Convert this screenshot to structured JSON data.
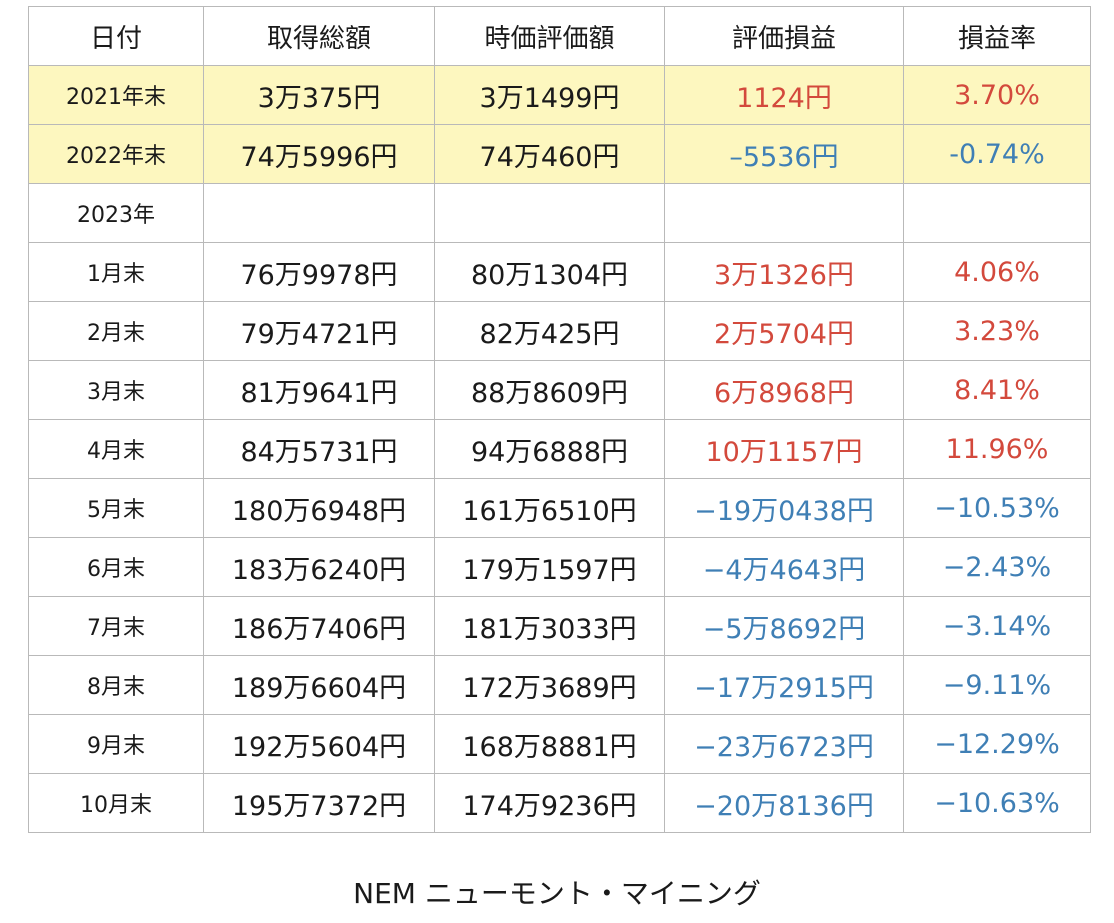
{
  "headers": {
    "date": "日付",
    "cost": "取得総額",
    "market": "時価評価額",
    "pl": "評価損益",
    "rate": "損益率"
  },
  "rows": [
    {
      "date": "2021年末",
      "cost": "3万375円",
      "market": "3万1499円",
      "pl": "1124円",
      "rate": "3.70%",
      "sign": "pos",
      "highlight": true
    },
    {
      "date": "2022年末",
      "cost": "74万5996円",
      "market": "74万460円",
      "pl": "–5536円",
      "rate": "-0.74%",
      "sign": "neg",
      "highlight": true
    },
    {
      "date": "2023年",
      "cost": "",
      "market": "",
      "pl": "",
      "rate": "",
      "sign": "",
      "highlight": false
    },
    {
      "date": "1月末",
      "cost": "76万9978円",
      "market": "80万1304円",
      "pl": "3万1326円",
      "rate": "4.06%",
      "sign": "pos",
      "highlight": false
    },
    {
      "date": "2月末",
      "cost": "79万4721円",
      "market": "82万425円",
      "pl": "2万5704円",
      "rate": "3.23%",
      "sign": "pos",
      "highlight": false
    },
    {
      "date": "3月末",
      "cost": "81万9641円",
      "market": "88万8609円",
      "pl": "6万8968円",
      "rate": "8.41%",
      "sign": "pos",
      "highlight": false
    },
    {
      "date": "4月末",
      "cost": "84万5731円",
      "market": "94万6888円",
      "pl": "10万1157円",
      "rate": "11.96%",
      "sign": "pos",
      "highlight": false
    },
    {
      "date": "5月末",
      "cost": "180万6948円",
      "market": "161万6510円",
      "pl": "−19万0438円",
      "rate": "−10.53%",
      "sign": "neg",
      "highlight": false
    },
    {
      "date": "6月末",
      "cost": "183万6240円",
      "market": "179万1597円",
      "pl": "−4万4643円",
      "rate": "−2.43%",
      "sign": "neg",
      "highlight": false
    },
    {
      "date": "7月末",
      "cost": "186万7406円",
      "market": "181万3033円",
      "pl": "−5万8692円",
      "rate": "−3.14%",
      "sign": "neg",
      "highlight": false
    },
    {
      "date": "8月末",
      "cost": "189万6604円",
      "market": "172万3689円",
      "pl": "−17万2915円",
      "rate": "−9.11%",
      "sign": "neg",
      "highlight": false
    },
    {
      "date": "9月末",
      "cost": "192万5604円",
      "market": "168万8881円",
      "pl": "−23万6723円",
      "rate": "−12.29%",
      "sign": "neg",
      "highlight": false
    },
    {
      "date": "10月末",
      "cost": "195万7372円",
      "market": "174万9236円",
      "pl": "−20万8136円",
      "rate": "−10.63%",
      "sign": "neg",
      "highlight": false
    }
  ],
  "colors": {
    "positive": "#d3493c",
    "negative": "#3f7fb5",
    "highlight_bg": "#fdf7bf",
    "border": "#b9b9b9"
  },
  "caption": "NEM ニューモント・マイニング"
}
